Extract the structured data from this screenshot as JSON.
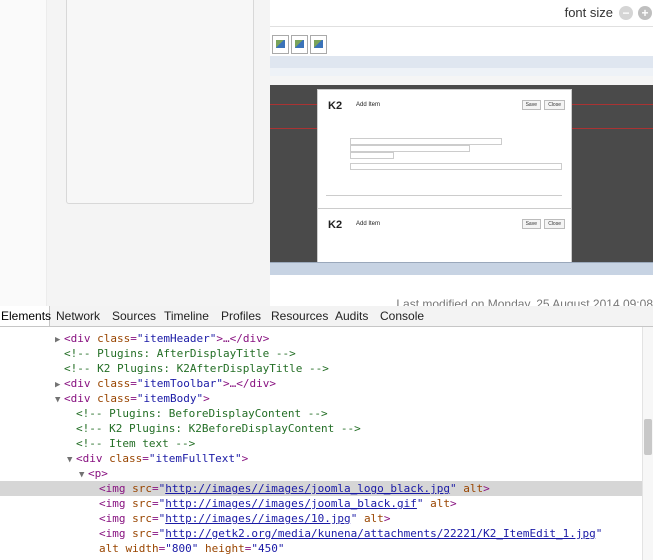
{
  "page": {
    "font_size_label": "font size",
    "font_minus": "−",
    "font_plus": "+",
    "last_modified": "Last modified on Monday, 25 August 2014 09:08"
  },
  "screenshot": {
    "logo": "K2",
    "title": "Add Item",
    "save": "Save",
    "close": "Close"
  },
  "devtools": {
    "tabs": [
      "Elements",
      "Network",
      "Sources",
      "Timeline",
      "Profiles",
      "Resources",
      "Audits",
      "Console"
    ],
    "active_tab": "Elements",
    "lines": {
      "l1_tag": "<div ",
      "l1_attr": "class",
      "l1_val": "\"itemHeader\"",
      "l1_rest": ">…</div>",
      "l2": "<!-- Plugins: AfterDisplayTitle -->",
      "l3": "<!-- K2 Plugins: K2AfterDisplayTitle -->",
      "l4_tag": "<div ",
      "l4_attr": "class",
      "l4_val": "\"itemToolbar\"",
      "l4_rest": ">…</div>",
      "l5_tag": "<div ",
      "l5_attr": "class",
      "l5_val": "\"itemBody\"",
      "l5_rest": ">",
      "l6": "<!-- Plugins: BeforeDisplayContent -->",
      "l7": "<!-- K2 Plugins: K2BeforeDisplayContent -->",
      "l8": "<!-- Item text -->",
      "l9_tag": "<div ",
      "l9_attr": "class",
      "l9_val": "\"itemFullText\"",
      "l9_rest": ">",
      "l10": "<p>",
      "img_tag": "<img ",
      "src_attr": "src",
      "alt_attr": "alt",
      "l11_link": "http://images//images/joomla_logo_black.jpg",
      "l12_link": "http://images//images/joomla_black.gif",
      "l13_link": "http://images//images/10.jpg",
      "l14_link": "http://getk2.org/media/kunena/attachments/22221/K2_ItemEdit_1.jpg",
      "l15_alt": "alt",
      "width_attr": "width",
      "width_val": "\"800\"",
      "height_attr": "height",
      "height_val": "\"450\""
    }
  },
  "colors": {
    "comment": "#236e25",
    "tag": "#881280",
    "attr_name": "#994500",
    "attr_value": "#1a1aa6",
    "selected_row": "#d6d6d6"
  }
}
